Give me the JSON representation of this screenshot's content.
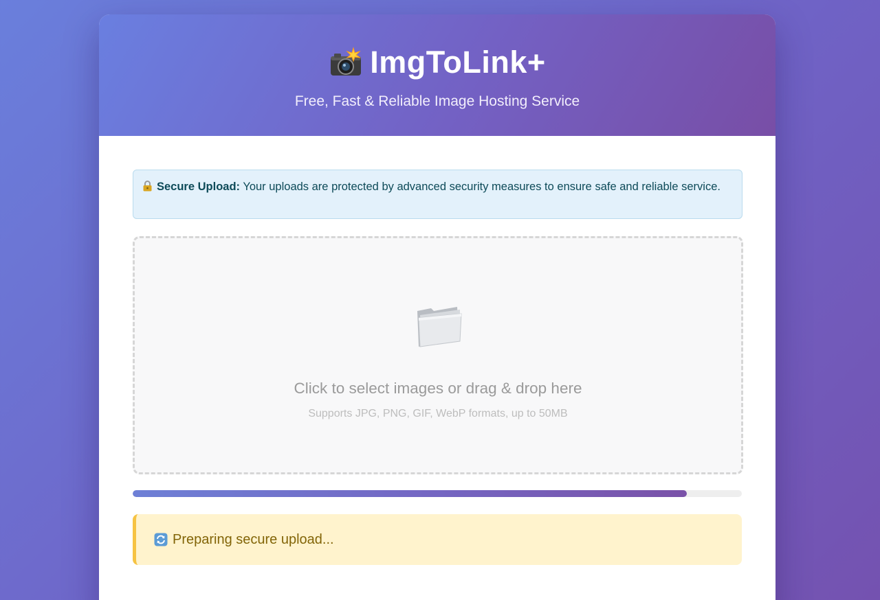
{
  "header": {
    "icon": "camera-flash-icon",
    "title": "ImgToLink+",
    "subtitle": "Free, Fast & Reliable Image Hosting Service"
  },
  "notice": {
    "icon": "lock-icon",
    "label": "Secure Upload:",
    "text": "Your uploads are protected by advanced security measures to ensure safe and reliable service."
  },
  "dropzone": {
    "icon": "folder-icon",
    "main_text": "Click to select images or drag & drop here",
    "sub_text": "Supports JPG, PNG, GIF, WebP formats, up to 50MB"
  },
  "progress": {
    "value_percent": 91
  },
  "status": {
    "icon": "refresh-icon",
    "text": "Preparing secure upload..."
  },
  "colors": {
    "accent_start": "#667eea",
    "accent_end": "#764ba2",
    "notice_bg": "#e3f1fb",
    "status_bg": "#fff3cd",
    "status_border": "#f6c343"
  }
}
